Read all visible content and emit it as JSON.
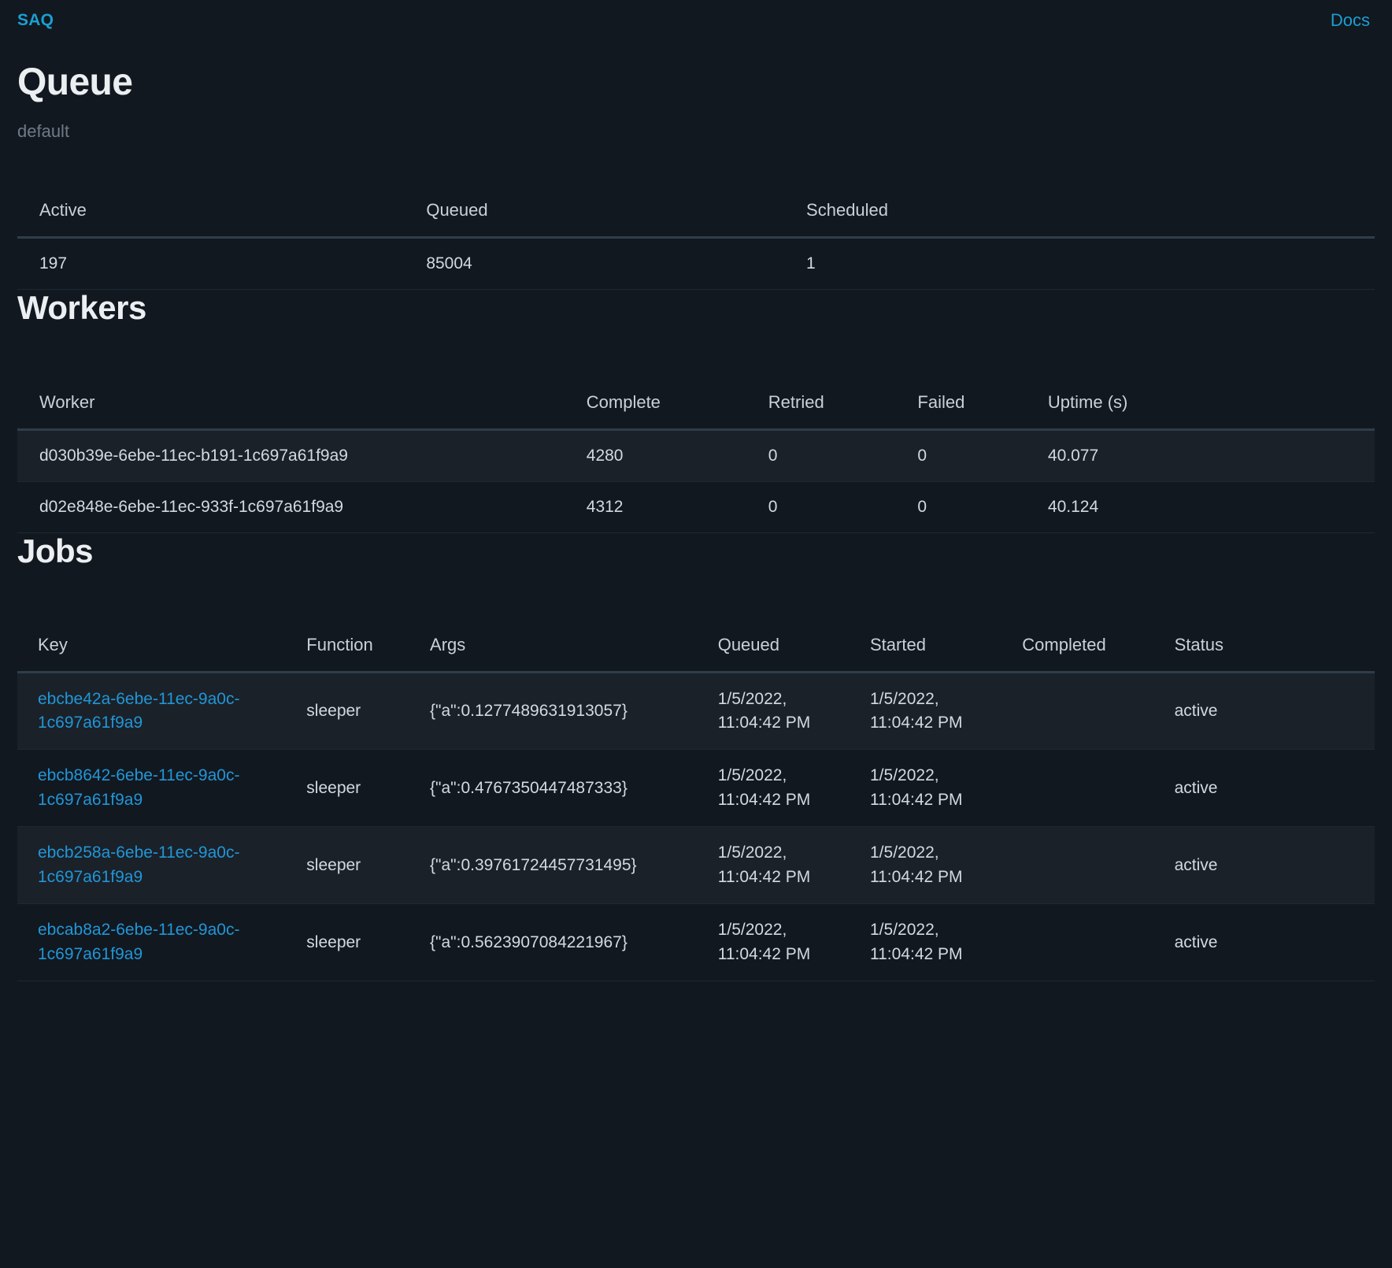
{
  "nav": {
    "brand": "SAQ",
    "docs_label": "Docs"
  },
  "queue": {
    "title": "Queue",
    "name": "default",
    "columns": [
      "Active",
      "Queued",
      "Scheduled"
    ],
    "row": {
      "active": "197",
      "queued": "85004",
      "scheduled": "1"
    }
  },
  "workers": {
    "title": "Workers",
    "columns": [
      "Worker",
      "Complete",
      "Retried",
      "Failed",
      "Uptime (s)"
    ],
    "rows": [
      {
        "worker": "d030b39e-6ebe-11ec-b191-1c697a61f9a9",
        "complete": "4280",
        "retried": "0",
        "failed": "0",
        "uptime": "40.077"
      },
      {
        "worker": "d02e848e-6ebe-11ec-933f-1c697a61f9a9",
        "complete": "4312",
        "retried": "0",
        "failed": "0",
        "uptime": "40.124"
      }
    ]
  },
  "jobs": {
    "title": "Jobs",
    "columns": [
      "Key",
      "Function",
      "Args",
      "Queued",
      "Started",
      "Completed",
      "Status"
    ],
    "rows": [
      {
        "key": "ebcbe42a-6ebe-11ec-9a0c-1c697a61f9a9",
        "function": "sleeper",
        "args": "{\"a\":0.1277489631913057}",
        "queued": "1/5/2022, 11:04:42 PM",
        "started": "1/5/2022, 11:04:42 PM",
        "completed": "",
        "status": "active"
      },
      {
        "key": "ebcb8642-6ebe-11ec-9a0c-1c697a61f9a9",
        "function": "sleeper",
        "args": "{\"a\":0.4767350447487333}",
        "queued": "1/5/2022, 11:04:42 PM",
        "started": "1/5/2022, 11:04:42 PM",
        "completed": "",
        "status": "active"
      },
      {
        "key": "ebcb258a-6ebe-11ec-9a0c-1c697a61f9a9",
        "function": "sleeper",
        "args": "{\"a\":0.39761724457731495}",
        "queued": "1/5/2022, 11:04:42 PM",
        "started": "1/5/2022, 11:04:42 PM",
        "completed": "",
        "status": "active"
      },
      {
        "key": "ebcab8a2-6ebe-11ec-9a0c-1c697a61f9a9",
        "function": "sleeper",
        "args": "{\"a\":0.5623907084221967}",
        "queued": "1/5/2022, 11:04:42 PM",
        "started": "1/5/2022, 11:04:42 PM",
        "completed": "",
        "status": "active"
      }
    ]
  },
  "colors": {
    "background": "#121820",
    "accent_link": "#1b9fd1",
    "row_stripe": "#1b2129",
    "header_rule": "#2f3d4a",
    "text_primary": "#dfe5ea",
    "text_muted": "#6e7b87"
  }
}
